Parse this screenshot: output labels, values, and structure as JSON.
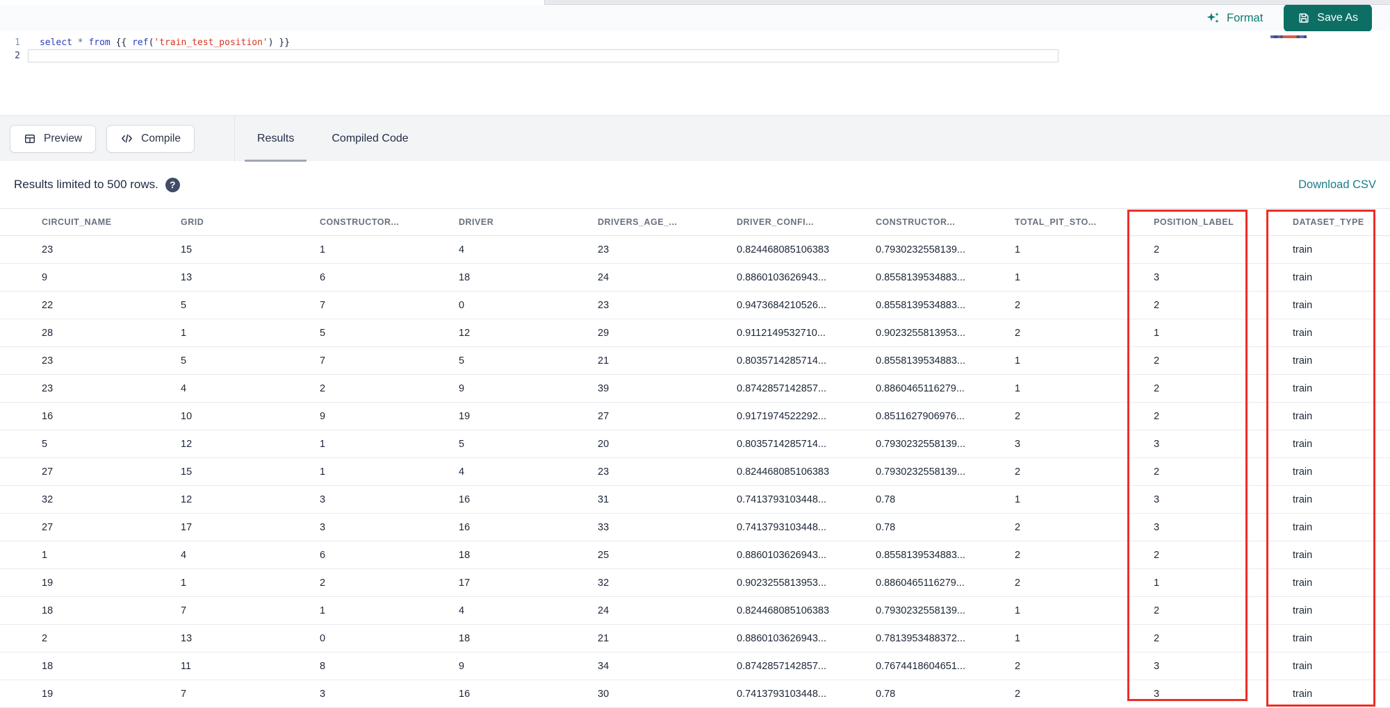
{
  "editor": {
    "format_label": "Format",
    "save_as_label": "Save As",
    "lines": [
      {
        "number": "1",
        "tokens": [
          {
            "t": "keyword",
            "s": "select"
          },
          {
            "t": "operator",
            "s": " * "
          },
          {
            "t": "keyword",
            "s": "from"
          },
          {
            "t": "plain",
            "s": " {{ "
          },
          {
            "t": "func",
            "s": "ref"
          },
          {
            "t": "plain",
            "s": "("
          },
          {
            "t": "string",
            "s": "'train_test_position'"
          },
          {
            "t": "plain",
            "s": ") }}"
          }
        ]
      },
      {
        "number": "2",
        "tokens": []
      }
    ]
  },
  "actions_bar": {
    "preview_label": "Preview",
    "compile_label": "Compile",
    "tabs": [
      {
        "label": "Results",
        "active": true
      },
      {
        "label": "Compiled Code",
        "active": false
      }
    ]
  },
  "results_bar": {
    "limit_text": "Results limited to 500 rows.",
    "help_glyph": "?",
    "download_label": "Download CSV"
  },
  "table": {
    "columns": [
      "CIRCUIT_NAME",
      "GRID",
      "CONSTRUCTOR...",
      "DRIVER",
      "DRIVERS_AGE_...",
      "DRIVER_CONFI...",
      "CONSTRUCTOR...",
      "TOTAL_PIT_STO...",
      "POSITION_LABEL",
      "DATASET_TYPE"
    ],
    "rows": [
      [
        "23",
        "15",
        "1",
        "4",
        "23",
        "0.824468085106383",
        "0.7930232558139...",
        "1",
        "2",
        "train"
      ],
      [
        "9",
        "13",
        "6",
        "18",
        "24",
        "0.8860103626943...",
        "0.8558139534883...",
        "1",
        "3",
        "train"
      ],
      [
        "22",
        "5",
        "7",
        "0",
        "23",
        "0.9473684210526...",
        "0.8558139534883...",
        "2",
        "2",
        "train"
      ],
      [
        "28",
        "1",
        "5",
        "12",
        "29",
        "0.9112149532710...",
        "0.9023255813953...",
        "2",
        "1",
        "train"
      ],
      [
        "23",
        "5",
        "7",
        "5",
        "21",
        "0.8035714285714...",
        "0.8558139534883...",
        "1",
        "2",
        "train"
      ],
      [
        "23",
        "4",
        "2",
        "9",
        "39",
        "0.8742857142857...",
        "0.8860465116279...",
        "1",
        "2",
        "train"
      ],
      [
        "16",
        "10",
        "9",
        "19",
        "27",
        "0.9171974522292...",
        "0.8511627906976...",
        "2",
        "2",
        "train"
      ],
      [
        "5",
        "12",
        "1",
        "5",
        "20",
        "0.8035714285714...",
        "0.7930232558139...",
        "3",
        "3",
        "train"
      ],
      [
        "27",
        "15",
        "1",
        "4",
        "23",
        "0.824468085106383",
        "0.7930232558139...",
        "2",
        "2",
        "train"
      ],
      [
        "32",
        "12",
        "3",
        "16",
        "31",
        "0.7413793103448...",
        "0.78",
        "1",
        "3",
        "train"
      ],
      [
        "27",
        "17",
        "3",
        "16",
        "33",
        "0.7413793103448...",
        "0.78",
        "2",
        "3",
        "train"
      ],
      [
        "1",
        "4",
        "6",
        "18",
        "25",
        "0.8860103626943...",
        "0.8558139534883...",
        "2",
        "2",
        "train"
      ],
      [
        "19",
        "1",
        "2",
        "17",
        "32",
        "0.9023255813953...",
        "0.8860465116279...",
        "2",
        "1",
        "train"
      ],
      [
        "18",
        "7",
        "1",
        "4",
        "24",
        "0.824468085106383",
        "0.7930232558139...",
        "1",
        "2",
        "train"
      ],
      [
        "2",
        "13",
        "0",
        "18",
        "21",
        "0.8860103626943...",
        "0.7813953488372...",
        "1",
        "2",
        "train"
      ],
      [
        "18",
        "11",
        "8",
        "9",
        "34",
        "0.8742857142857...",
        "0.7674418604651...",
        "2",
        "3",
        "train"
      ],
      [
        "19",
        "7",
        "3",
        "16",
        "30",
        "0.7413793103448...",
        "0.78",
        "2",
        "3",
        "train"
      ]
    ],
    "highlighted_columns": [
      "POSITION_LABEL",
      "DATASET_TYPE"
    ]
  },
  "colors": {
    "accent_teal": "#0e7c72",
    "save_button_teal": "#0d6e64",
    "download_teal": "#177f87",
    "highlight_red": "#ee2d26",
    "keyword_blue": "#2a3cc0",
    "string_red": "#d63420"
  },
  "icons": {
    "format": "sparkles-icon",
    "save": "save-icon",
    "preview": "table-icon",
    "compile": "code-icon",
    "help": "question-icon"
  }
}
